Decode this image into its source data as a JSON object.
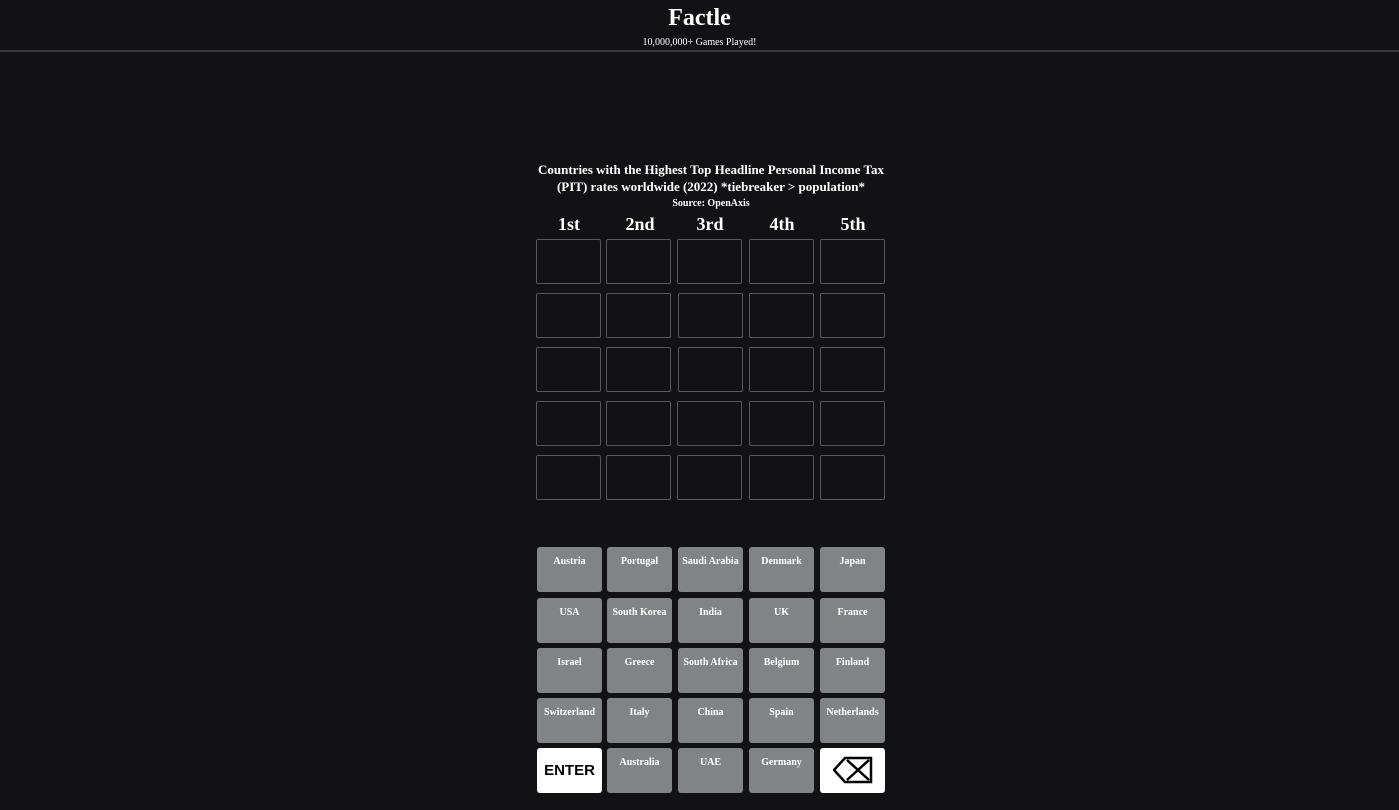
{
  "header": {
    "title": "Factle",
    "subtitle": "10,000,000+ Games Played!"
  },
  "puzzle": {
    "question": "Countries with the Highest Top Headline Personal Income Tax (PIT) rates worldwide (2022) *tiebreaker > population*",
    "source": "Source: OpenAxis",
    "rank_labels": [
      "1st",
      "2nd",
      "3rd",
      "4th",
      "5th"
    ]
  },
  "board": {
    "rows": [
      [
        "",
        "",
        "",
        "",
        ""
      ],
      [
        "",
        "",
        "",
        "",
        ""
      ],
      [
        "",
        "",
        "",
        "",
        ""
      ],
      [
        "",
        "",
        "",
        "",
        ""
      ],
      [
        "",
        "",
        "",
        "",
        ""
      ]
    ]
  },
  "keyboard": {
    "rows": [
      [
        "Austria",
        "Portugal",
        "Saudi Arabia",
        "Denmark",
        "Japan"
      ],
      [
        "USA",
        "South Korea",
        "India",
        "UK",
        "France"
      ],
      [
        "Israel",
        "Greece",
        "South Africa",
        "Belgium",
        "Finland"
      ],
      [
        "Switzerland",
        "Italy",
        "China",
        "Spain",
        "Netherlands"
      ],
      [
        "ENTER",
        "Australia",
        "UAE",
        "Germany",
        "backspace-icon"
      ]
    ],
    "enter_label": "ENTER",
    "backspace_icon": "backspace-icon"
  },
  "colors": {
    "background": "#121214",
    "cell_border": "#565758",
    "key_background": "#818384",
    "action_key_background": "#ffffff"
  }
}
